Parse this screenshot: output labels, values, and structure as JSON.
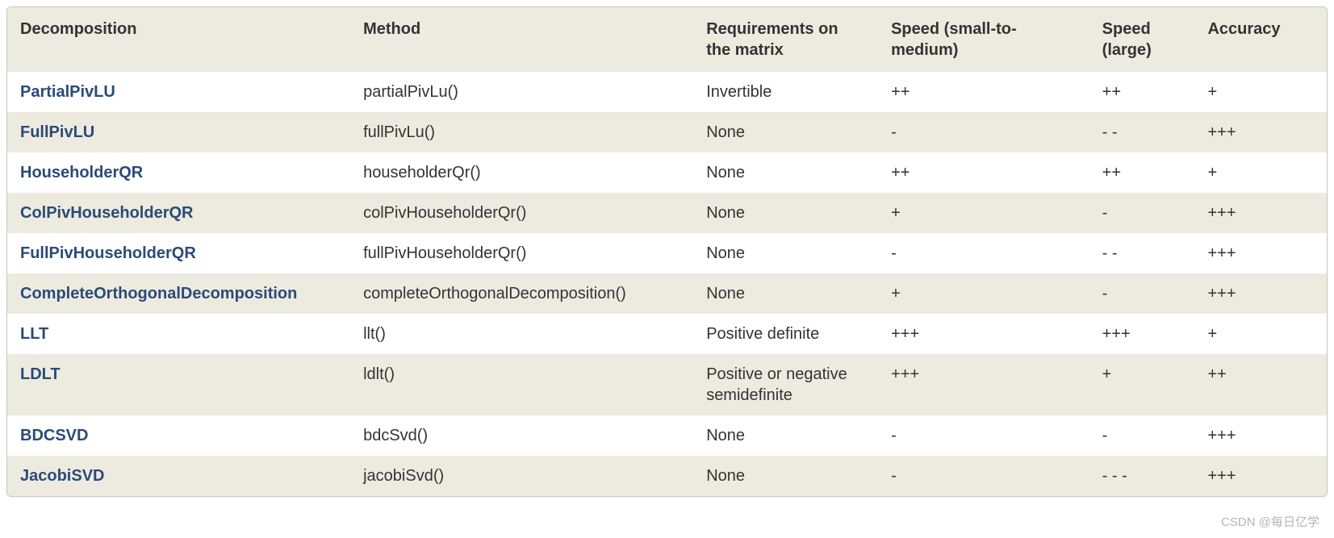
{
  "headers": {
    "decomposition": "Decomposition",
    "method": "Method",
    "requirements": "Requirements on the matrix",
    "speed_small": "Speed (small-to-medium)",
    "speed_large": "Speed (large)",
    "accuracy": "Accuracy"
  },
  "rows": [
    {
      "decomposition": "PartialPivLU",
      "method": "partialPivLu()",
      "requirements": "Invertible",
      "speed_small": "++",
      "speed_large": "++",
      "accuracy": "+"
    },
    {
      "decomposition": "FullPivLU",
      "method": "fullPivLu()",
      "requirements": "None",
      "speed_small": "-",
      "speed_large": "- -",
      "accuracy": "+++"
    },
    {
      "decomposition": "HouseholderQR",
      "method": "householderQr()",
      "requirements": "None",
      "speed_small": "++",
      "speed_large": "++",
      "accuracy": "+"
    },
    {
      "decomposition": "ColPivHouseholderQR",
      "method": "colPivHouseholderQr()",
      "requirements": "None",
      "speed_small": "+",
      "speed_large": "-",
      "accuracy": "+++"
    },
    {
      "decomposition": "FullPivHouseholderQR",
      "method": "fullPivHouseholderQr()",
      "requirements": "None",
      "speed_small": "-",
      "speed_large": "- -",
      "accuracy": "+++"
    },
    {
      "decomposition": "CompleteOrthogonalDecomposition",
      "method": "completeOrthogonalDecomposition()",
      "requirements": "None",
      "speed_small": "+",
      "speed_large": "-",
      "accuracy": "+++"
    },
    {
      "decomposition": "LLT",
      "method": "llt()",
      "requirements": "Positive definite",
      "speed_small": "+++",
      "speed_large": "+++",
      "accuracy": "+"
    },
    {
      "decomposition": "LDLT",
      "method": "ldlt()",
      "requirements": "Positive or negative semidefinite",
      "speed_small": "+++",
      "speed_large": "+",
      "accuracy": "++"
    },
    {
      "decomposition": "BDCSVD",
      "method": "bdcSvd()",
      "requirements": "None",
      "speed_small": "-",
      "speed_large": "-",
      "accuracy": "+++"
    },
    {
      "decomposition": "JacobiSVD",
      "method": "jacobiSvd()",
      "requirements": "None",
      "speed_small": "-",
      "speed_large": "- - -",
      "accuracy": "+++"
    }
  ],
  "watermark": "CSDN @每日亿学"
}
